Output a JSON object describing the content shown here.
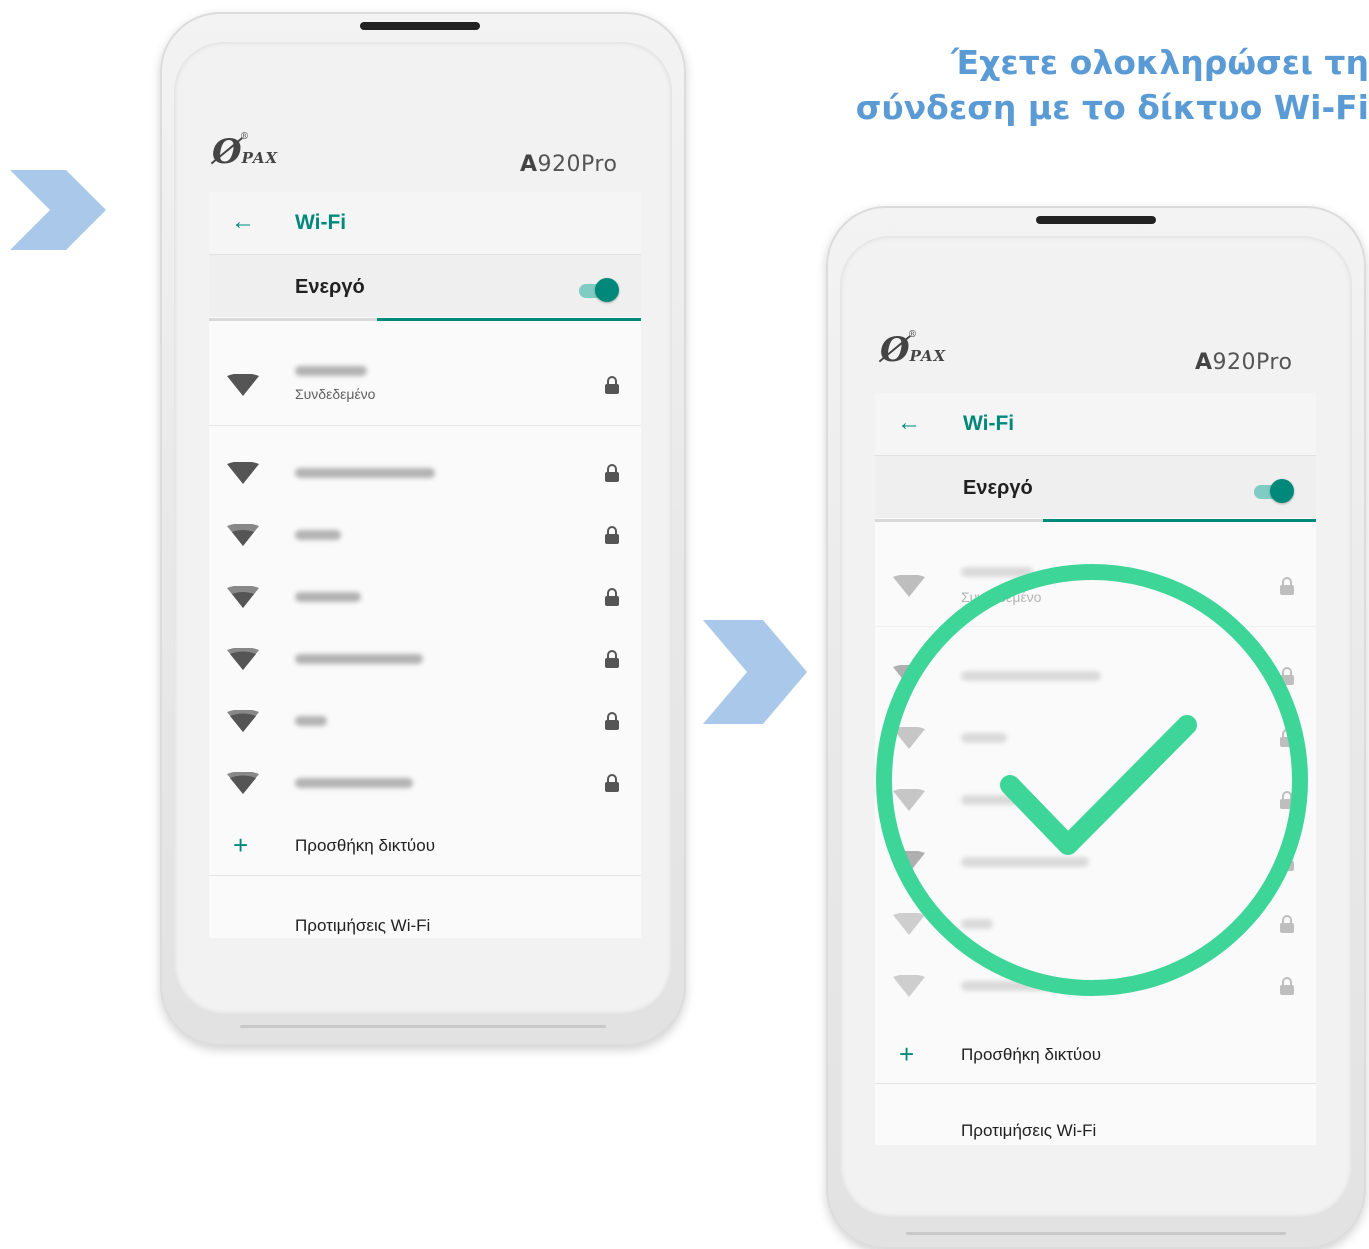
{
  "heading": {
    "line1": "Έχετε ολοκληρώσει τη",
    "line2": "σύνδεση με το δίκτυο Wi-Fi"
  },
  "colors": {
    "accent": "#00897b",
    "arrow": "#a9c8ea",
    "heading": "#5b9bd5",
    "check": "#3dd598"
  },
  "device": {
    "brand": "PAX",
    "model_bold": "A",
    "model_rest": "920Pro"
  },
  "wifi_screen": {
    "back_icon": "arrow-left-icon",
    "title": "Wi-Fi",
    "switch_label": "Ενεργό",
    "switch_on": true,
    "connected_status": "Συνδεδεμένο",
    "add_network": "Προσθήκη δικτύου",
    "preferences": "Προτιμήσεις Wi-Fi"
  },
  "success_overlay": {
    "icon": "check-circle-icon"
  }
}
